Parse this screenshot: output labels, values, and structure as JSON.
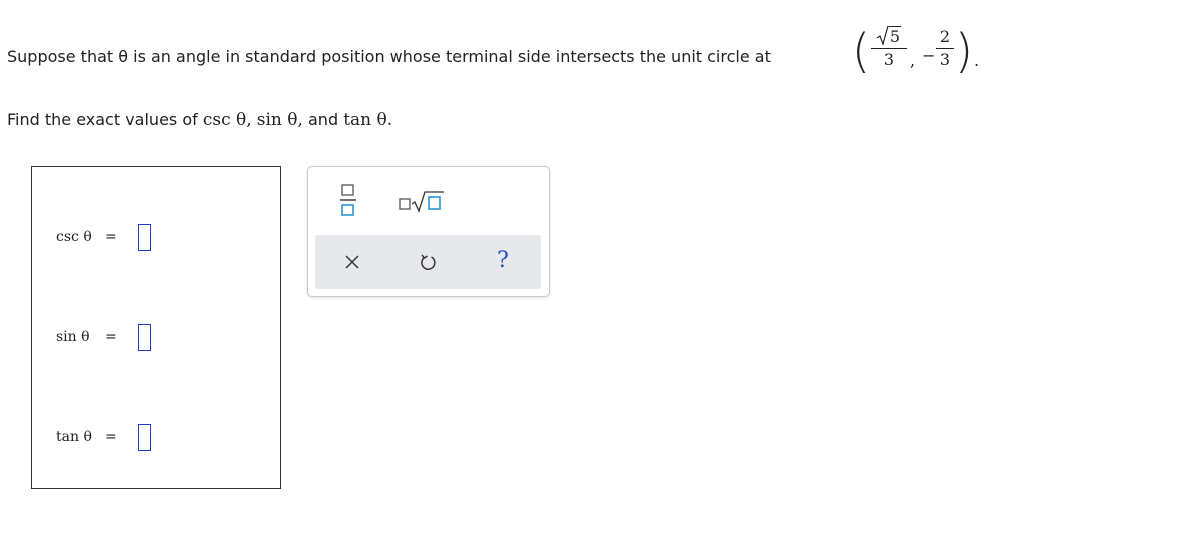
{
  "problem": {
    "text": "Suppose that θ is an angle in standard position whose terminal side intersects the unit circle at",
    "point": {
      "x_num": "5",
      "x_den": "3",
      "y_sign": "−",
      "y_num": "2",
      "y_den": "3",
      "comma": ",",
      "period": "."
    }
  },
  "find": {
    "prefix": "Find the exact values of",
    "f1": "csc θ,",
    "f2": "sin θ,",
    "and": "and",
    "f3": "tan θ."
  },
  "answers": [
    {
      "label": "csc θ",
      "eq": "=",
      "value": ""
    },
    {
      "label": "sin θ",
      "eq": "=",
      "value": ""
    },
    {
      "label": "tan θ",
      "eq": "=",
      "value": ""
    }
  ],
  "palette": {
    "tools": [
      "fraction-icon",
      "sqrt-icon"
    ],
    "actions": [
      "clear-icon",
      "undo-icon",
      "help-icon"
    ],
    "help_glyph": "?",
    "clear_glyph": "×",
    "accent": "#1e90c8"
  }
}
